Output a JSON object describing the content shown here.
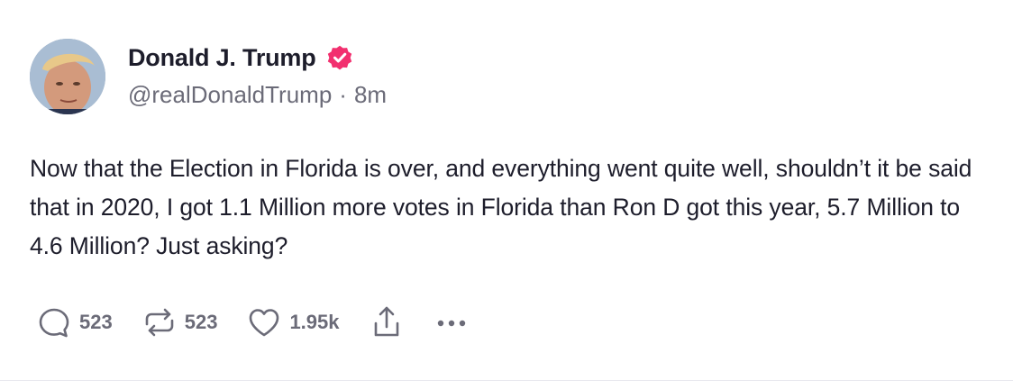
{
  "post": {
    "author": {
      "display_name": "Donald J. Trump",
      "verified": true,
      "handle": "@realDonaldTrump",
      "separator": "·",
      "timestamp": "8m"
    },
    "text": "Now that the Election in Florida is over, and everything went quite well, shouldn’t it be said that in 2020, I got 1.1 Million more votes in Florida than Ron D got this year, 5.7 Million to 4.6 Million? Just asking?",
    "actions": {
      "reply_count": "523",
      "repost_count": "523",
      "like_count": "1.95k"
    }
  },
  "colors": {
    "verified_badge": "#f2306f",
    "text_primary": "#1d1d2b",
    "text_secondary": "#6b6b78",
    "background": "#ffffff"
  },
  "icons": {
    "reply": "reply-icon",
    "repost": "repost-icon",
    "like": "heart-icon",
    "share": "share-icon",
    "more": "more-icon",
    "verified": "verified-badge-icon"
  }
}
